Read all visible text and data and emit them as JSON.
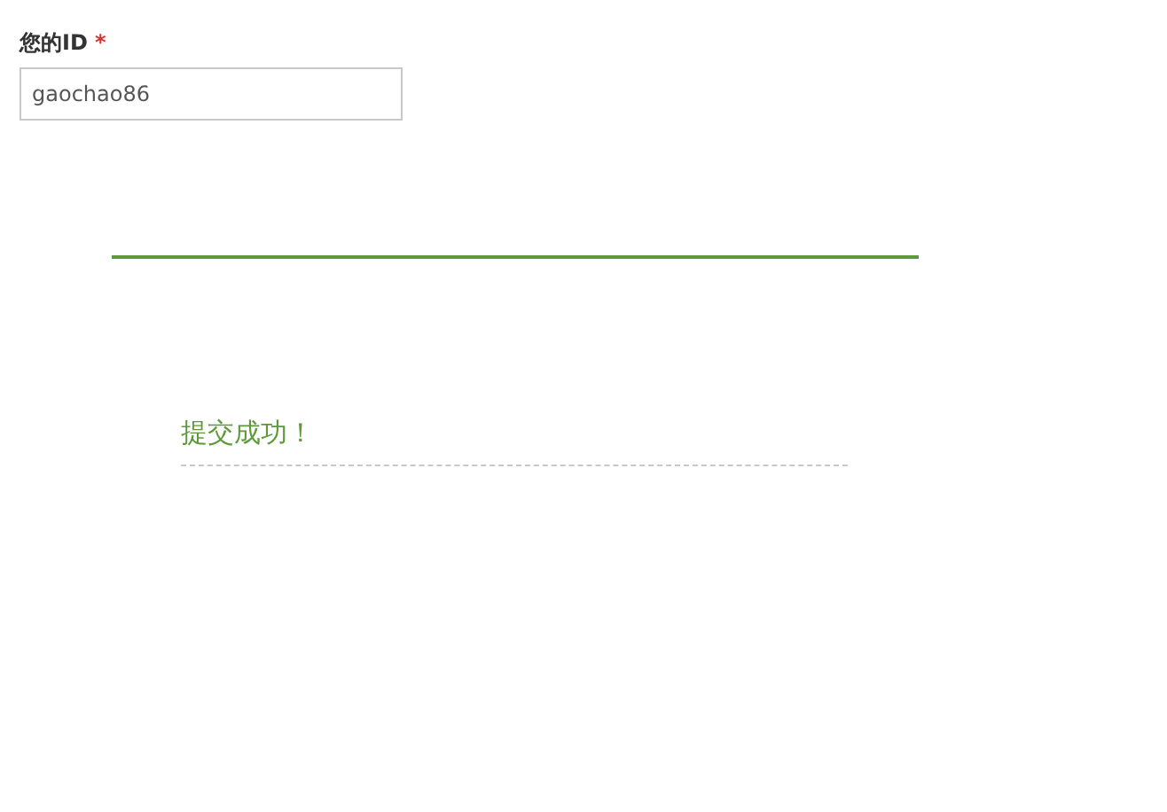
{
  "field": {
    "label": "您的ID",
    "required_mark": "*",
    "value": "gaochao86"
  },
  "message": {
    "text": "提交成功！"
  }
}
